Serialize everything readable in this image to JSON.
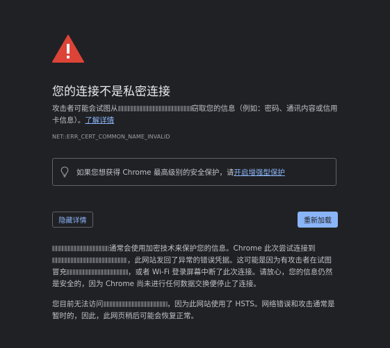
{
  "heading": {
    "title": "您的连接不是私密连接",
    "icon": "warning-triangle-icon",
    "icon_color": "#db4437"
  },
  "intro": {
    "prefix": "攻击者可能会试图从",
    "suffix": "窃取您的信息（例如：密码、通讯内容或信用卡信息）。",
    "learn_more_link": "了解详情"
  },
  "error_code": "NET::ERR_CERT_COMMON_NAME_INVALID",
  "protection": {
    "icon": "lightbulb-icon",
    "text": "如果您想获得 Chrome 最高级别的安全保护，请",
    "link": "开启增强型保护"
  },
  "buttons": {
    "details_label": "隐藏详情",
    "reload_label": "重新加载"
  },
  "details": {
    "paragraph1_part1": "通常会使用加密技术来保护您的信息。Chrome 此次尝试连接到",
    "paragraph1_part2": "，此网站发回了异常的错误凭据。这可能是因为有攻击者在试图冒充",
    "paragraph1_part3": "，或者 Wi-Fi 登录屏幕中断了此次连接。请放心，您的信息仍然是安全的，因为 Chrome 尚未进行任何数据交换便停止了连接。",
    "paragraph2_part1": "您目前无法访问",
    "paragraph2_part2": "，因为此网站使用了 HSTS。网络错误和攻击通常是暂时的，因此，此网页稍后可能会恢复正常。"
  },
  "colors": {
    "background": "#202124",
    "link": "#8ab4f8",
    "button_primary": "#8ab4f8"
  }
}
